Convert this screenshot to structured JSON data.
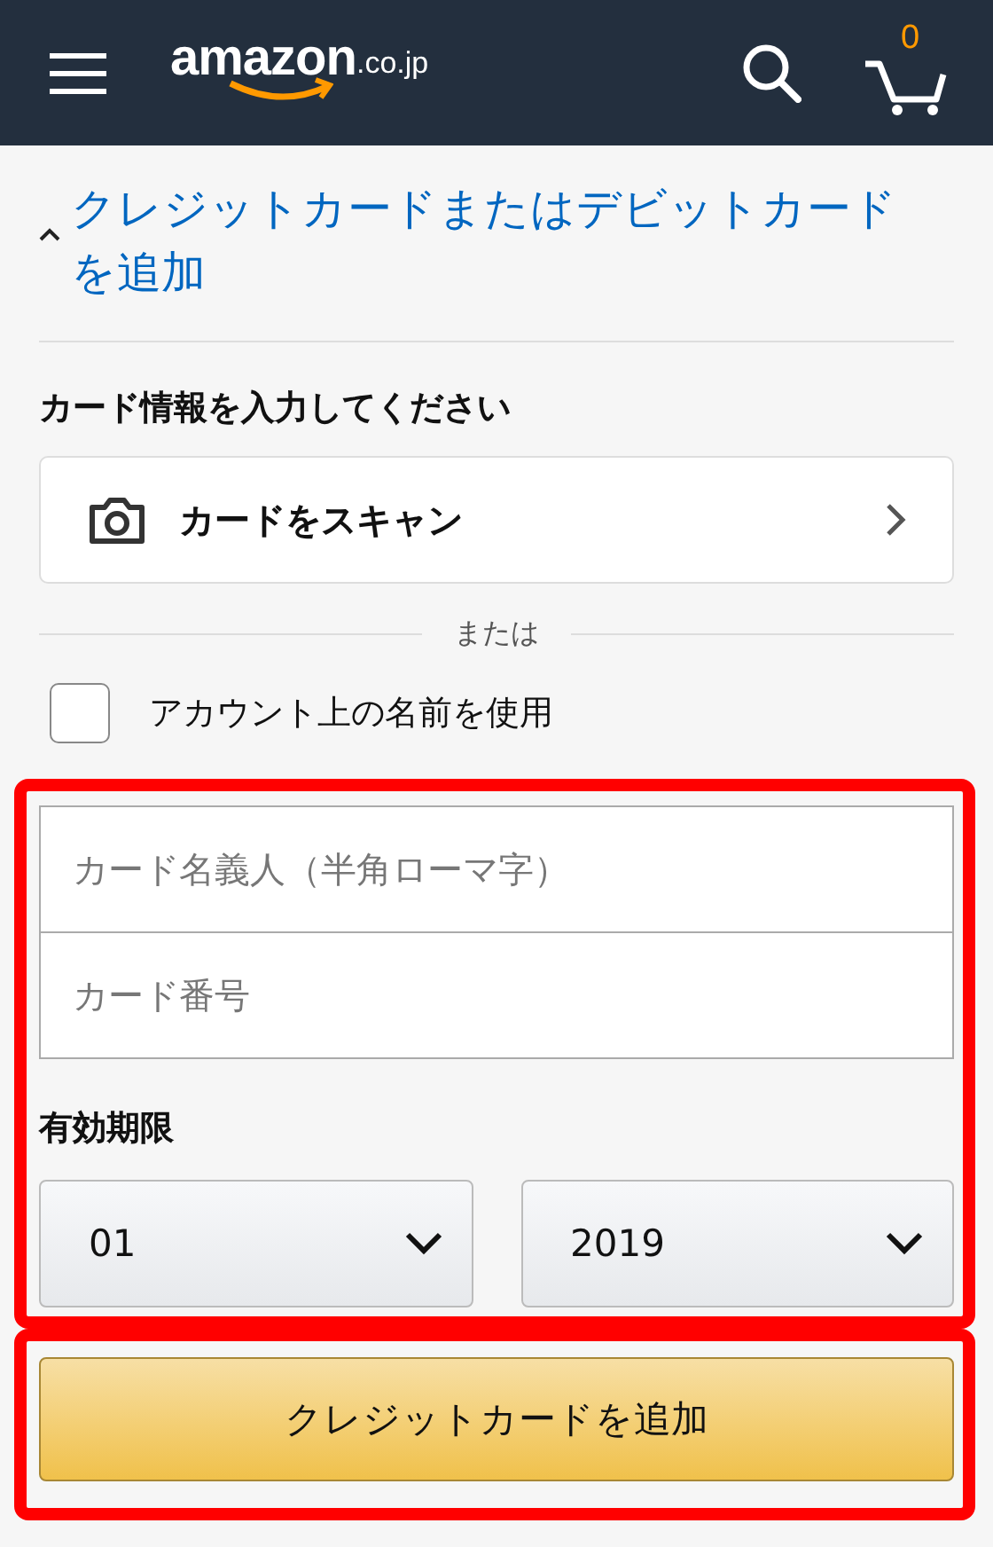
{
  "header": {
    "logo": "amazon",
    "logo_suffix": ".co.jp",
    "cart_count": "0"
  },
  "section": {
    "title": "クレジットカードまたはデビットカードを追加",
    "expanded": true
  },
  "form": {
    "heading": "カード情報を入力してください",
    "scan_button": "カードをスキャン",
    "divider": "または",
    "use_account_name": {
      "label": "アカウント上の名前を使用",
      "checked": false
    },
    "fields": [
      {
        "placeholder": "カード名義人（半角ローマ字）"
      },
      {
        "placeholder": "カード番号"
      }
    ],
    "expiry_label": "有効期限",
    "selects": [
      {
        "value": "01"
      },
      {
        "value": "2019"
      }
    ],
    "submit": "クレジットカードを追加"
  }
}
